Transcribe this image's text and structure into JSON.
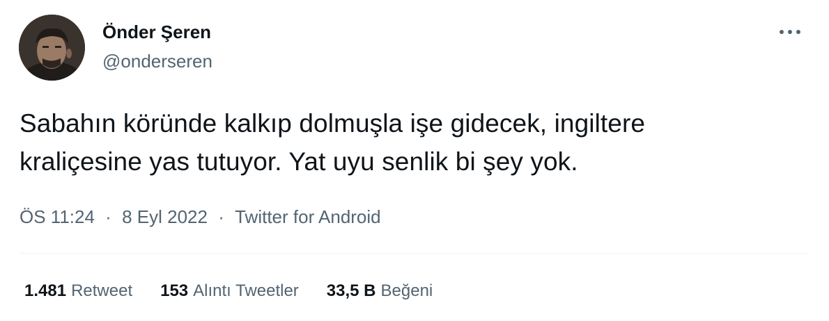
{
  "user": {
    "display_name": "Önder Şeren",
    "handle": "@onderseren",
    "avatar_icon": "user-avatar-photo"
  },
  "tweet": {
    "text_lines": [
      "Sabahın köründe kalkıp dolmuşla işe gidecek, ingiltere",
      "kraliçesine yas tutuyor. Yat uyu senlik bi şey yok."
    ]
  },
  "meta": {
    "time": "ÖS 11:24",
    "separator": "·",
    "date": "8 Eyl 2022",
    "source": "Twitter for Android"
  },
  "stats": {
    "retweets": {
      "value": "1.481",
      "label": "Retweet"
    },
    "quotes": {
      "value": "153",
      "label": "Alıntı Tweetler"
    },
    "likes": {
      "value": "33,5 B",
      "label": "Beğeni"
    }
  },
  "icons": {
    "more": "more-horizontal-icon"
  },
  "colors": {
    "text_primary": "#0f1419",
    "text_secondary": "#536471",
    "divider": "#eff3f4",
    "background": "#ffffff"
  }
}
